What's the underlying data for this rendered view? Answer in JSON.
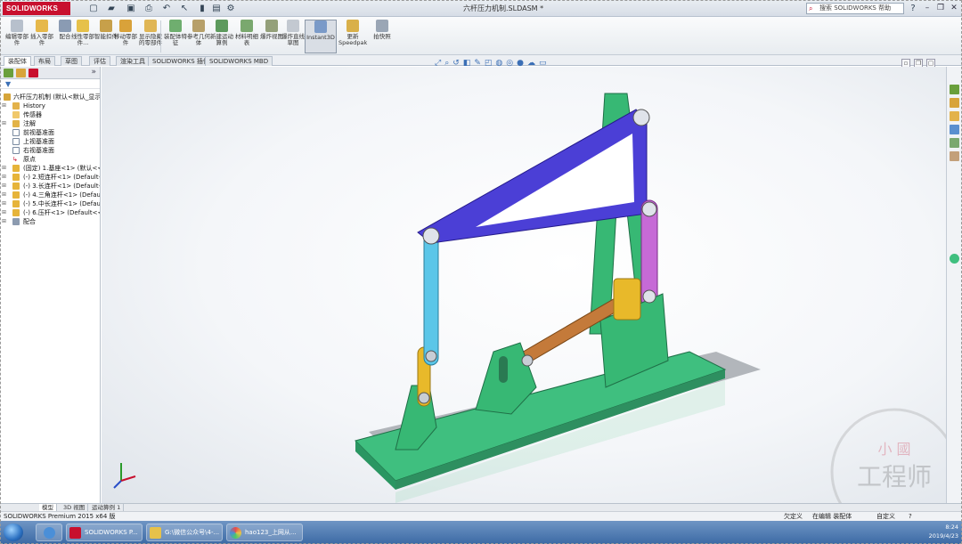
{
  "app": {
    "logo": "SOLIDWORKS",
    "window_title": "六杆压力机制.SLDASM *",
    "help_search_placeholder": "搜索 SOLIDWORKS 帮助",
    "help_button": "?"
  },
  "commands": [
    {
      "label": "编辑零部件"
    },
    {
      "label": "插入零部件"
    },
    {
      "label": "配合"
    },
    {
      "label": "线性零部件..."
    },
    {
      "label": "智能扣件"
    },
    {
      "label": "移动零部件"
    },
    {
      "label": "显示隐藏的零部件"
    },
    {
      "label": "装配体特征"
    },
    {
      "label": "参考几何体"
    },
    {
      "label": "新建运动算例"
    },
    {
      "label": "材料明细表"
    },
    {
      "label": "爆炸视图"
    },
    {
      "label": "爆炸直线草图"
    },
    {
      "label": "Instant3D"
    },
    {
      "label": "更新Speedpak"
    },
    {
      "label": "拍快照"
    }
  ],
  "tabs": [
    {
      "label": "装配体"
    },
    {
      "label": "布局"
    },
    {
      "label": "草图"
    },
    {
      "label": "评估"
    },
    {
      "label": "渲染工具"
    },
    {
      "label": "SOLIDWORKS 插件"
    },
    {
      "label": "SOLIDWORKS MBD"
    }
  ],
  "feature_tree": {
    "chevron": "»",
    "root": "六杆压力机制 (默认<默认_显示",
    "items": [
      {
        "label": "History"
      },
      {
        "label": "传感器"
      },
      {
        "label": "注解"
      },
      {
        "label": "前视基准面"
      },
      {
        "label": "上视基准面"
      },
      {
        "label": "右视基准面"
      },
      {
        "label": "原点"
      },
      {
        "label": "(固定) 1.基座<1> (默认<<默"
      },
      {
        "label": "(-) 2.短连杆<1> (Default<<"
      },
      {
        "label": "(-) 3.长连杆<1> (Default<<"
      },
      {
        "label": "(-) 4.三角连杆<1> (Default"
      },
      {
        "label": "(-) 5.中长连杆<1> (Default"
      },
      {
        "label": "(-) 6.压杆<1> (Default<<D"
      },
      {
        "label": "配合"
      }
    ]
  },
  "bottom_tabs": [
    {
      "label": "模型"
    },
    {
      "label": "3D 视图"
    },
    {
      "label": "运动算例 1"
    }
  ],
  "status": {
    "left": "SOLIDWORKS Premium 2015 x64 版",
    "under_defined": "欠定义",
    "editing": "在编辑 装配体",
    "custom": "自定义",
    "help": "?"
  },
  "taskbar": {
    "buttons": [
      {
        "label": "SOLIDWORKS P..."
      },
      {
        "label": "G:\\微信公众号\\4-..."
      },
      {
        "label": "hao123_上网从..."
      }
    ],
    "time": "8:24",
    "date": "2019/4/23"
  },
  "watermark": {
    "line1": "小 國",
    "line2": "工程师"
  },
  "colors": {
    "base": "#3fbf7f",
    "triangle_link": "#4b3fd6",
    "long_link": "#5bc6e8",
    "mid_link": "#c66ad6",
    "short_link": "#e8b92a",
    "press_rod": "#c47a3a"
  }
}
